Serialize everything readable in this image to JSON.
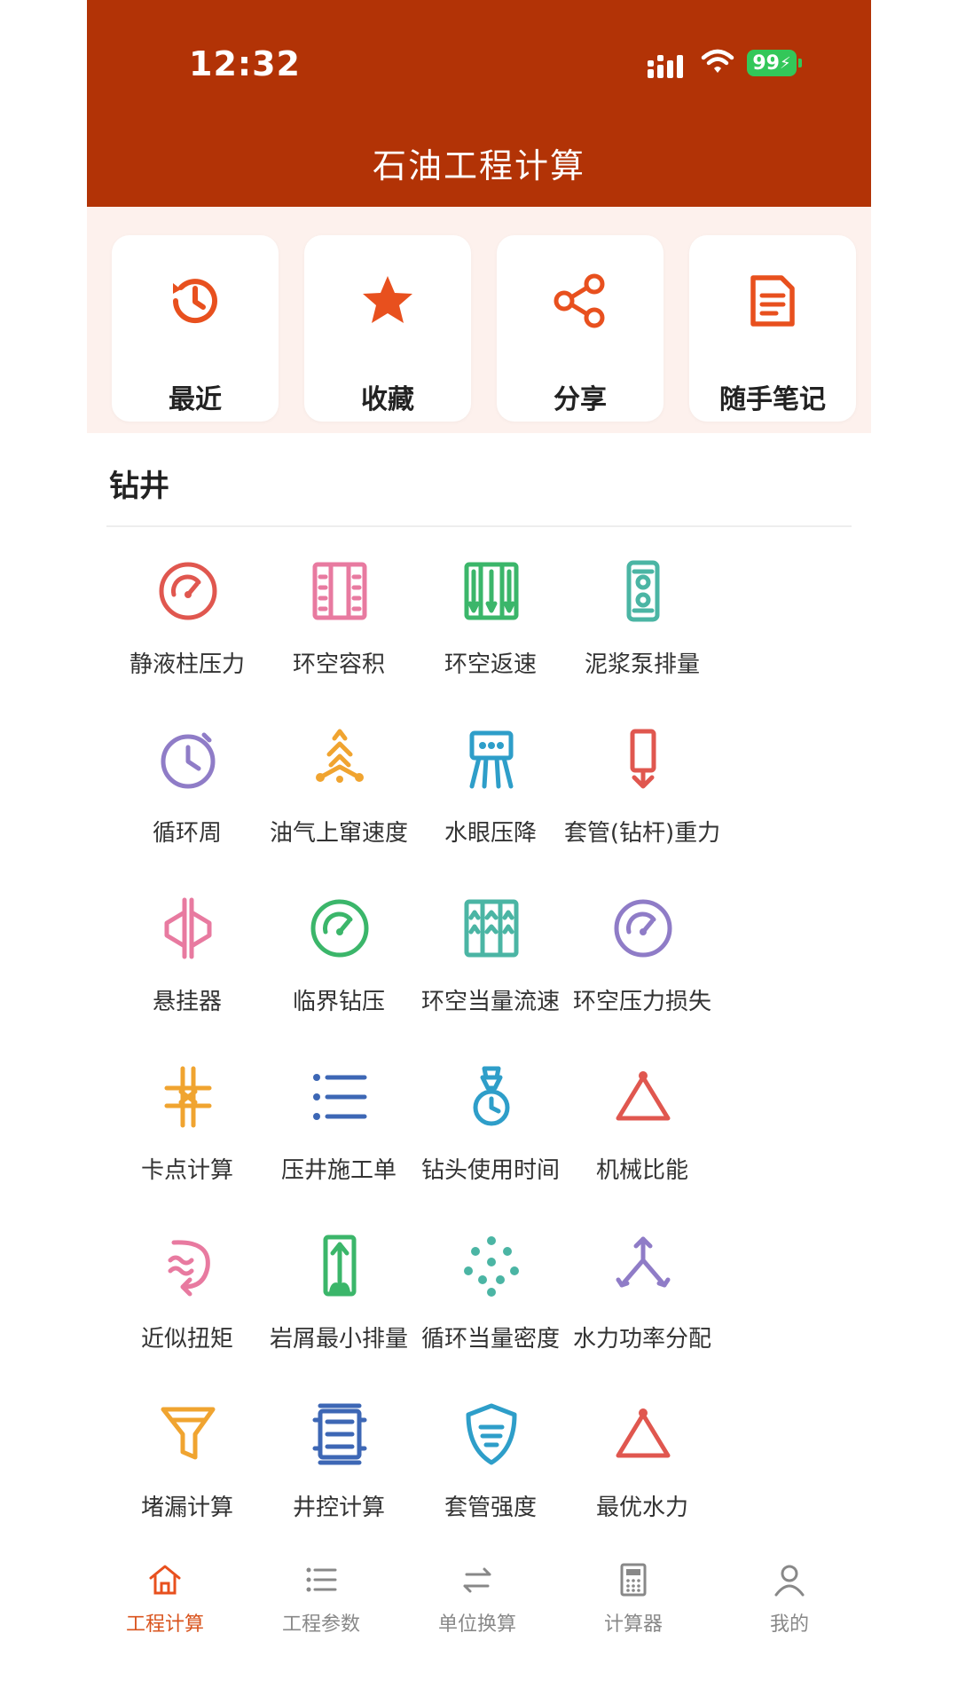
{
  "status_bar": {
    "time": "12:32",
    "battery": "99"
  },
  "header": {
    "title": "石油工程计算"
  },
  "quick_actions": [
    {
      "label": "最近",
      "icon": "history-icon"
    },
    {
      "label": "收藏",
      "icon": "star-icon"
    },
    {
      "label": "分享",
      "icon": "share-icon"
    },
    {
      "label": "随手笔记",
      "icon": "note-icon"
    }
  ],
  "section": {
    "title": "钻井"
  },
  "tools": [
    {
      "label": "静液柱压力",
      "icon": "gauge-icon",
      "color": "#e0574f"
    },
    {
      "label": "环空容积",
      "icon": "annulus-volume-icon",
      "color": "#e87aa0"
    },
    {
      "label": "环空返速",
      "icon": "annulus-velocity-icon",
      "color": "#3bb66a"
    },
    {
      "label": "泥浆泵排量",
      "icon": "mud-pump-icon",
      "color": "#4bb5a4"
    },
    {
      "label": "循环周",
      "icon": "clock-icon",
      "color": "#8f7cc7"
    },
    {
      "label": "油气上窜速度",
      "icon": "rise-icon",
      "color": "#f0a430"
    },
    {
      "label": "水眼压降",
      "icon": "nozzle-icon",
      "color": "#2e9ec9"
    },
    {
      "label": "套管(钻杆)重力",
      "icon": "down-arrow-icon",
      "color": "#e0574f"
    },
    {
      "label": "悬挂器",
      "icon": "hanger-icon",
      "color": "#e87aa0"
    },
    {
      "label": "临界钻压",
      "icon": "gauge-icon",
      "color": "#3bb66a"
    },
    {
      "label": "环空当量流速",
      "icon": "annulus-flow-icon",
      "color": "#4bb5a4"
    },
    {
      "label": "环空压力损失",
      "icon": "gauge-icon",
      "color": "#8f7cc7"
    },
    {
      "label": "卡点计算",
      "icon": "stuck-point-icon",
      "color": "#f0a430"
    },
    {
      "label": "压井施工单",
      "icon": "list-icon",
      "color": "#3d67b5"
    },
    {
      "label": "钻头使用时间",
      "icon": "bit-timer-icon",
      "color": "#2e9ec9"
    },
    {
      "label": "机械比能",
      "icon": "triangle-icon",
      "color": "#e0574f"
    },
    {
      "label": "近似扭矩",
      "icon": "torque-icon",
      "color": "#e87aa0"
    },
    {
      "label": "岩屑最小排量",
      "icon": "cuttings-icon",
      "color": "#3bb66a"
    },
    {
      "label": "循环当量密度",
      "icon": "dots-icon",
      "color": "#4bb5a4"
    },
    {
      "label": "水力功率分配",
      "icon": "split-icon",
      "color": "#8f7cc7"
    },
    {
      "label": "堵漏计算",
      "icon": "funnel-icon",
      "color": "#f0a430"
    },
    {
      "label": "井控计算",
      "icon": "well-control-icon",
      "color": "#3d67b5"
    },
    {
      "label": "套管强度",
      "icon": "shield-icon",
      "color": "#2e9ec9"
    },
    {
      "label": "最优水力",
      "icon": "triangle-icon",
      "color": "#e0574f"
    }
  ],
  "tabbar": [
    {
      "label": "工程计算",
      "icon": "home-icon",
      "active": true
    },
    {
      "label": "工程参数",
      "icon": "list-icon",
      "active": false
    },
    {
      "label": "单位换算",
      "icon": "swap-icon",
      "active": false
    },
    {
      "label": "计算器",
      "icon": "calculator-icon",
      "active": false
    },
    {
      "label": "我的",
      "icon": "profile-icon",
      "active": false
    }
  ],
  "colors": {
    "header": "#b23306",
    "accent": "#e8501e",
    "quick_bg": "#fdf1ed"
  }
}
